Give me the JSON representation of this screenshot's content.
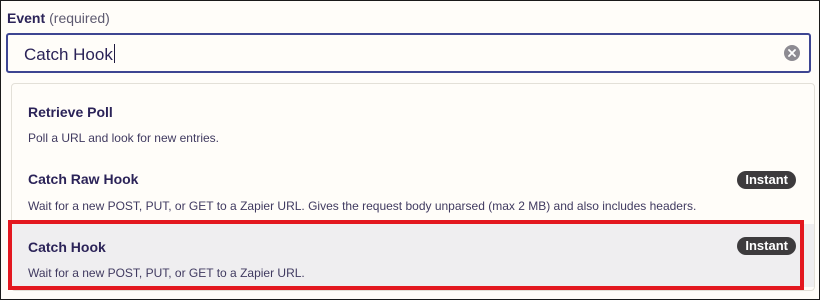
{
  "field": {
    "label": "Event",
    "required_text": "(required)",
    "value": "Catch Hook"
  },
  "icons": {
    "clear": "close-circle-icon"
  },
  "options": [
    {
      "title": "Retrieve Poll",
      "description": "Poll a URL and look for new entries.",
      "badge": ""
    },
    {
      "title": "Catch Raw Hook",
      "description": "Wait for a new POST, PUT, or GET to a Zapier URL. Gives the request body unparsed (max 2 MB) and also includes headers.",
      "badge": "Instant"
    },
    {
      "title": "Catch Hook",
      "description": "Wait for a new POST, PUT, or GET to a Zapier URL.",
      "badge": "Instant"
    }
  ],
  "colors": {
    "input_border": "#3d4592",
    "highlight": "#e3171f",
    "badge_bg": "#3d3b3d",
    "selected_row_bg": "#efeef0"
  }
}
